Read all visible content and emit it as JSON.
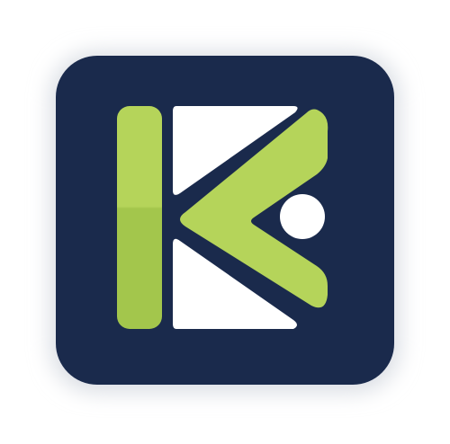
{
  "app_icon": {
    "icon_name": "k-letter-logo-icon",
    "colors": {
      "tile_background": "#1a2a4c",
      "tile_shadow": "#d9dde3",
      "accent_green": "#b5d45a",
      "accent_green_dark": "#a3c64c",
      "white": "#ffffff"
    }
  }
}
